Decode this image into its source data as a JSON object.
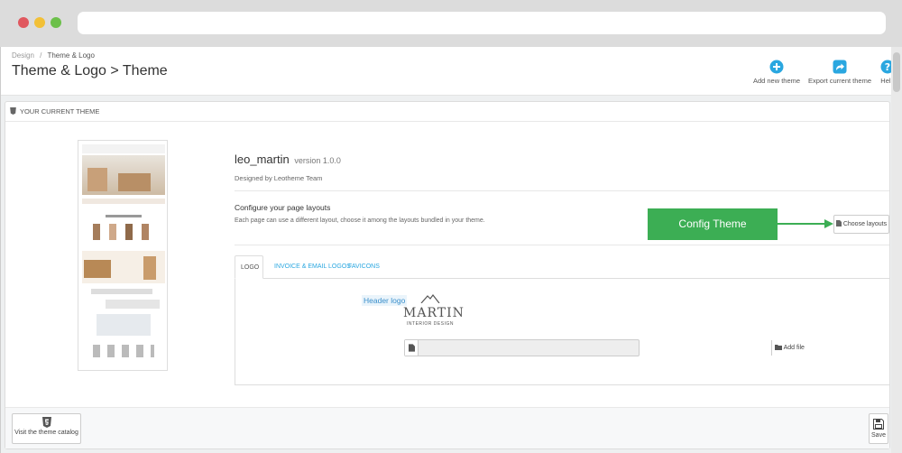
{
  "header": {
    "breadcrumb_root": "Design",
    "breadcrumb_sep": "/",
    "breadcrumb_current": "Theme & Logo",
    "title": "Theme & Logo > Theme",
    "actions": {
      "add_theme": "Add new theme",
      "export_theme": "Export current theme",
      "help": "Help"
    }
  },
  "panel": {
    "heading": "Your current theme",
    "theme_name": "leo_martin",
    "version": "version 1.0.0",
    "designer": "Designed by Leotheme Team",
    "layouts_title": "Configure your page layouts",
    "layouts_desc": "Each page can use a different layout, choose it among the layouts bundled in your theme.",
    "choose_layouts": "Choose layouts",
    "annotation": "Config Theme"
  },
  "tabs": [
    {
      "label": "Logo"
    },
    {
      "label": "Invoice & Email Logos"
    },
    {
      "label": "Favicons"
    }
  ],
  "logo_tab": {
    "header_logo_label": "Header logo",
    "brand": "MARTIN",
    "brand_sub": "INTERIOR DESIGN",
    "add_file": "Add file"
  },
  "footer": {
    "catalog": "Visit the theme catalog",
    "save": "Save"
  },
  "colors": {
    "accent": "#2aa7e0",
    "annotation": "#3cae54"
  }
}
